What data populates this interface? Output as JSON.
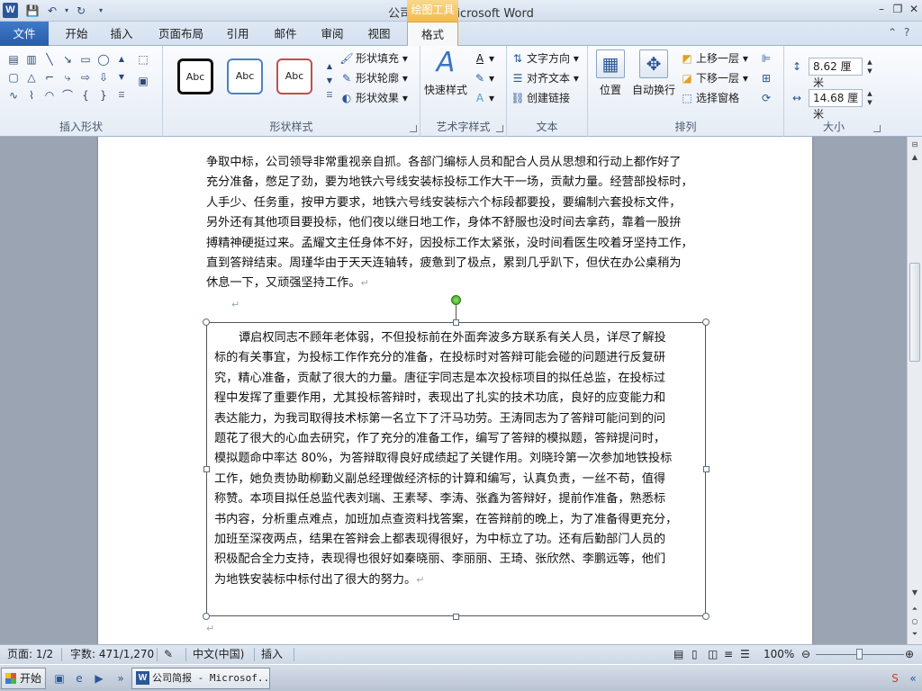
{
  "window": {
    "title": "公司简报 - Microsoft Word",
    "app_logo": "W",
    "context_tab_group": "绘图工具"
  },
  "tabs": [
    "开始",
    "插入",
    "页面布局",
    "引用",
    "邮件",
    "审阅",
    "视图"
  ],
  "file_tab": "文件",
  "active_tab": "格式",
  "ribbon": {
    "groups": {
      "insert_shapes": "插入形状",
      "shape_styles": "形状样式",
      "wordart_styles": "艺术字样式",
      "text": "文本",
      "arrange": "排列",
      "size": "大小"
    },
    "style_swatch_label": "Abc",
    "shape_fill": "形状填充",
    "shape_outline": "形状轮廓",
    "shape_effects": "形状效果",
    "quick_styles": "快速样式",
    "text_direction": "文字方向",
    "align_text": "对齐文本",
    "create_link": "创建链接",
    "position": "位置",
    "wrap_text": "自动换行",
    "bring_forward": "上移一层",
    "send_backward": "下移一层",
    "selection_pane": "选择窗格",
    "height": "8.62 厘米",
    "width": "14.68 厘米",
    "colors": {
      "accent": "#2b5797",
      "context": "#f2b94a"
    }
  },
  "document": {
    "body_lines": [
      "争取中标，公司领导非常重视亲自抓。各部门编标人员和配合人员从思想和行动上都作好了",
      "充分准备，憋足了劲，要为地铁六号线安装标投标工作大干一场，贡献力量。经营部投标时，",
      "人手少、任务重，按甲方要求，地铁六号线安装标六个标段都要投，要编制六套投标文件，",
      "另外还有其他项目要投标，他们夜以继日地工作，身体不舒服也没时间去拿药，靠着一股拚",
      "搏精神硬挺过来。孟耀文主任身体不好，因投标工作太紧张，没时间看医生咬着牙坚持工作，",
      "直到答辩结束。周瑾华由于天天连轴转，疲惫到了极点，累到几乎趴下，但伏在办公桌稍为",
      "休息一下，又顽强坚持工作。"
    ],
    "textbox_lines": [
      "谭启权同志不顾年老体弱，不但投标前在外面奔波多方联系有关人员，详尽了解投",
      "标的有关事宜，为投标工作作充分的准备，在投标时对答辩可能会碰的问题进行反复研",
      "究，精心准备，贡献了很大的力量。唐征宇同志是本次投标项目的拟任总监，在投标过",
      "程中发挥了重要作用，尤其投标答辩时，表现出了扎实的技术功底，良好的应变能力和",
      "表达能力，为我司取得技术标第一名立下了汗马功劳。王涛同志为了答辩可能问到的问",
      "题花了很大的心血去研究，作了充分的准备工作，编写了答辩的模拟题，答辩提问时，",
      "模拟题命中率达  80%，为答辩取得良好成绩起了关键作用。刘晓玲第一次参加地铁投标",
      "工作，她负责协助柳勤义副总经理做经济标的计算和编写，认真负责，一丝不苟，值得",
      "称赞。本项目拟任总监代表刘瑞、王素琴、李涛、张鑫为答辩好，提前作准备，熟悉标",
      "书内容，分析重点难点，加班加点查资料找答案，在答辩前的晚上，为了准备得更充分，",
      "加班至深夜两点，结果在答辩会上都表现得很好，为中标立了功。还有后勤部门人员的",
      "积极配合全力支持，表现得也很好如秦晓丽、李丽丽、王琦、张欣然、李鹏远等，他们",
      "为地铁安装标中标付出了很大的努力。"
    ],
    "pilcrow": "↵"
  },
  "status": {
    "page": "页面: 1/2",
    "words": "字数: 471/1,270",
    "language": "中文(中国)",
    "mode": "插入",
    "zoom": "100%",
    "zoom_level": 1.0
  },
  "taskbar": {
    "start": "开始",
    "word_task": "公司简报 - Microsof..."
  }
}
